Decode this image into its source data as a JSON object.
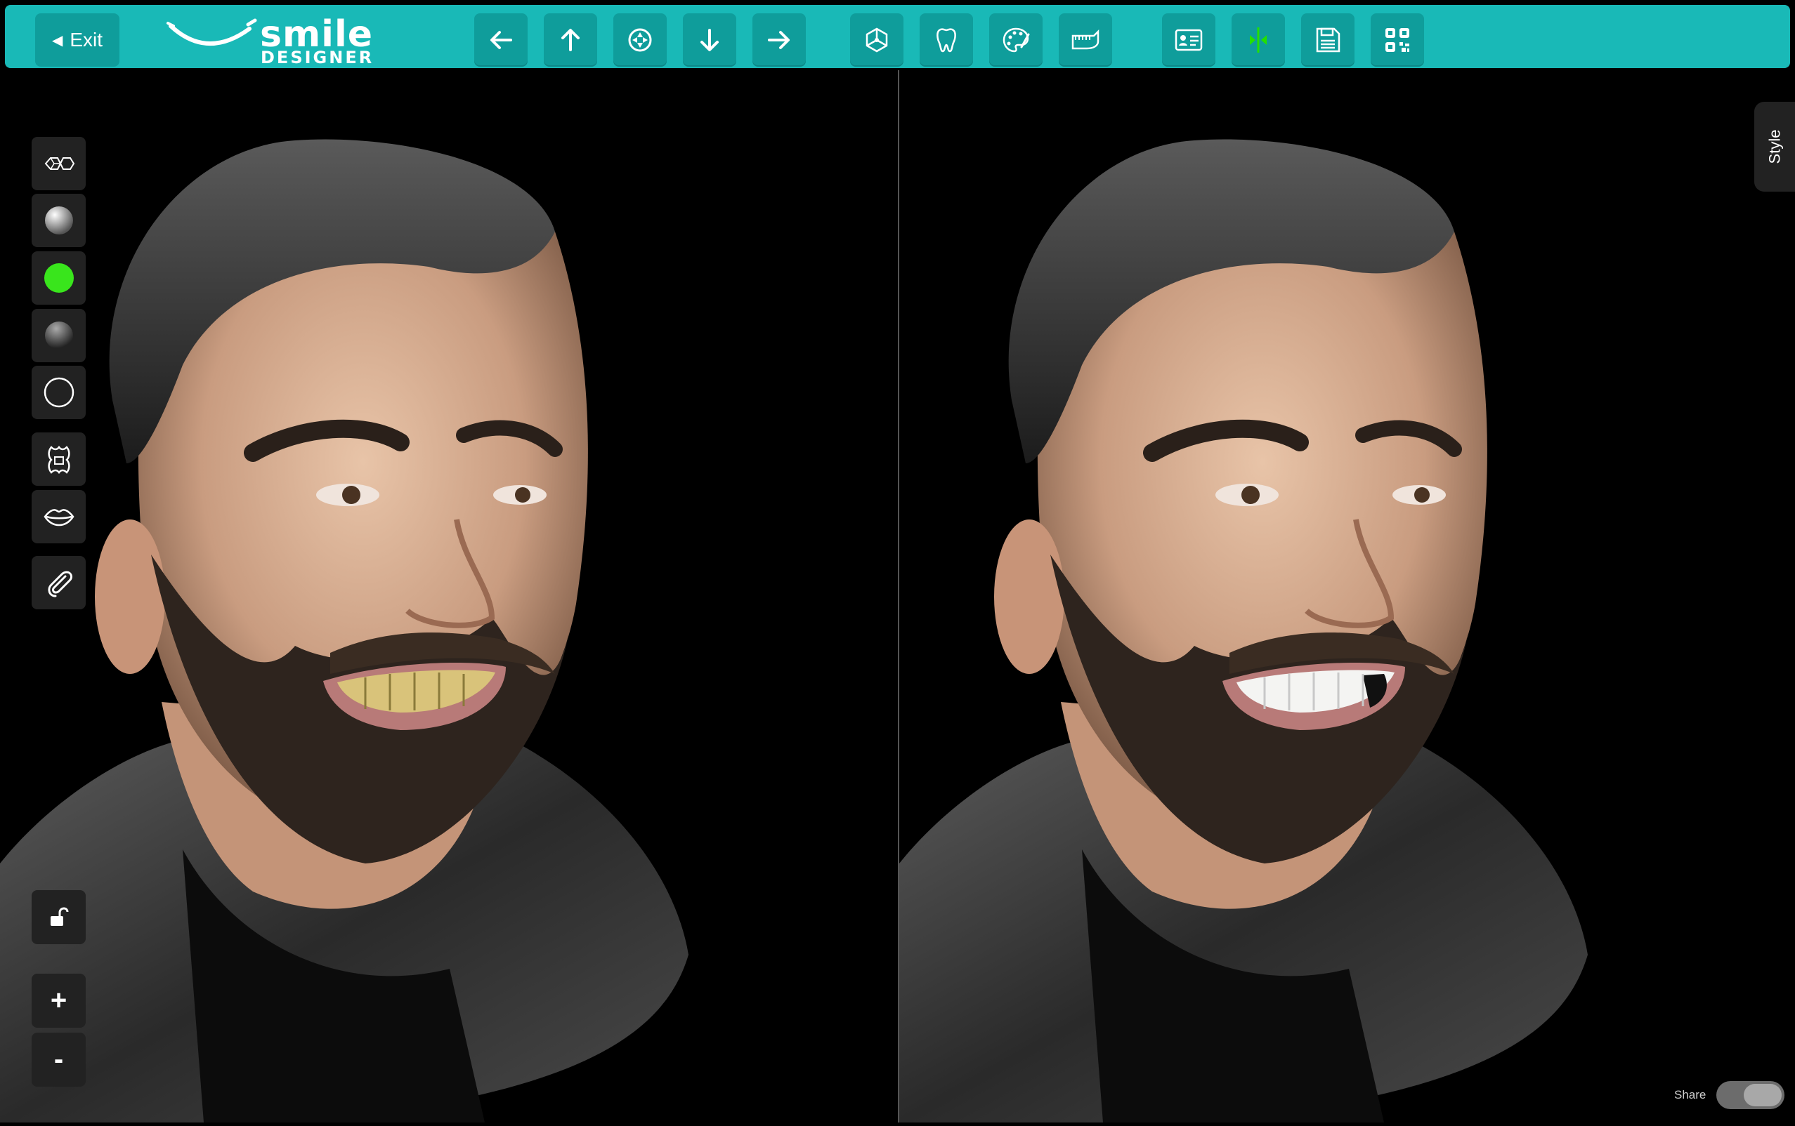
{
  "toolbar": {
    "exit_label": "Exit",
    "logo_top": "smile",
    "logo_bottom": "DESIGNER",
    "buttons": [
      {
        "name": "rotate-left",
        "icon": "arrow-left-icon"
      },
      {
        "name": "rotate-up",
        "icon": "arrow-up-icon"
      },
      {
        "name": "recenter",
        "icon": "center-target-icon"
      },
      {
        "name": "rotate-down",
        "icon": "arrow-down-icon"
      },
      {
        "name": "rotate-right",
        "icon": "arrow-right-icon"
      },
      {
        "name": "3d-view",
        "icon": "cube-axes-icon"
      },
      {
        "name": "tooth",
        "icon": "tooth-icon"
      },
      {
        "name": "palette",
        "icon": "palette-icon"
      },
      {
        "name": "dental-arch",
        "icon": "jaw-icon"
      },
      {
        "name": "patient-card",
        "icon": "id-card-icon"
      },
      {
        "name": "split-view",
        "icon": "split-arrows-icon"
      },
      {
        "name": "save",
        "icon": "save-icon"
      },
      {
        "name": "qr-code",
        "icon": "qr-code-icon"
      }
    ],
    "split_accent": "#23e000"
  },
  "side_tools": [
    {
      "name": "texture-toggle",
      "icon": "mesh-texture-icon"
    },
    {
      "name": "material-gloss",
      "icon": "white-sphere-icon"
    },
    {
      "name": "material-green",
      "icon": "green-dot-icon",
      "color": "#39e51c"
    },
    {
      "name": "material-dark",
      "icon": "dark-sphere-icon"
    },
    {
      "name": "material-outline",
      "icon": "outline-circle-icon"
    },
    {
      "name": "teeth-tool",
      "icon": "teeth-tool-icon"
    },
    {
      "name": "lips-tool",
      "icon": "lips-icon"
    },
    {
      "name": "attachments",
      "icon": "paperclip-icon"
    }
  ],
  "bottom_tools": {
    "lock_icon": "unlock-icon",
    "zoom_in": "+",
    "zoom_out": "-"
  },
  "style_tab": "Style",
  "share": {
    "label": "Share"
  }
}
